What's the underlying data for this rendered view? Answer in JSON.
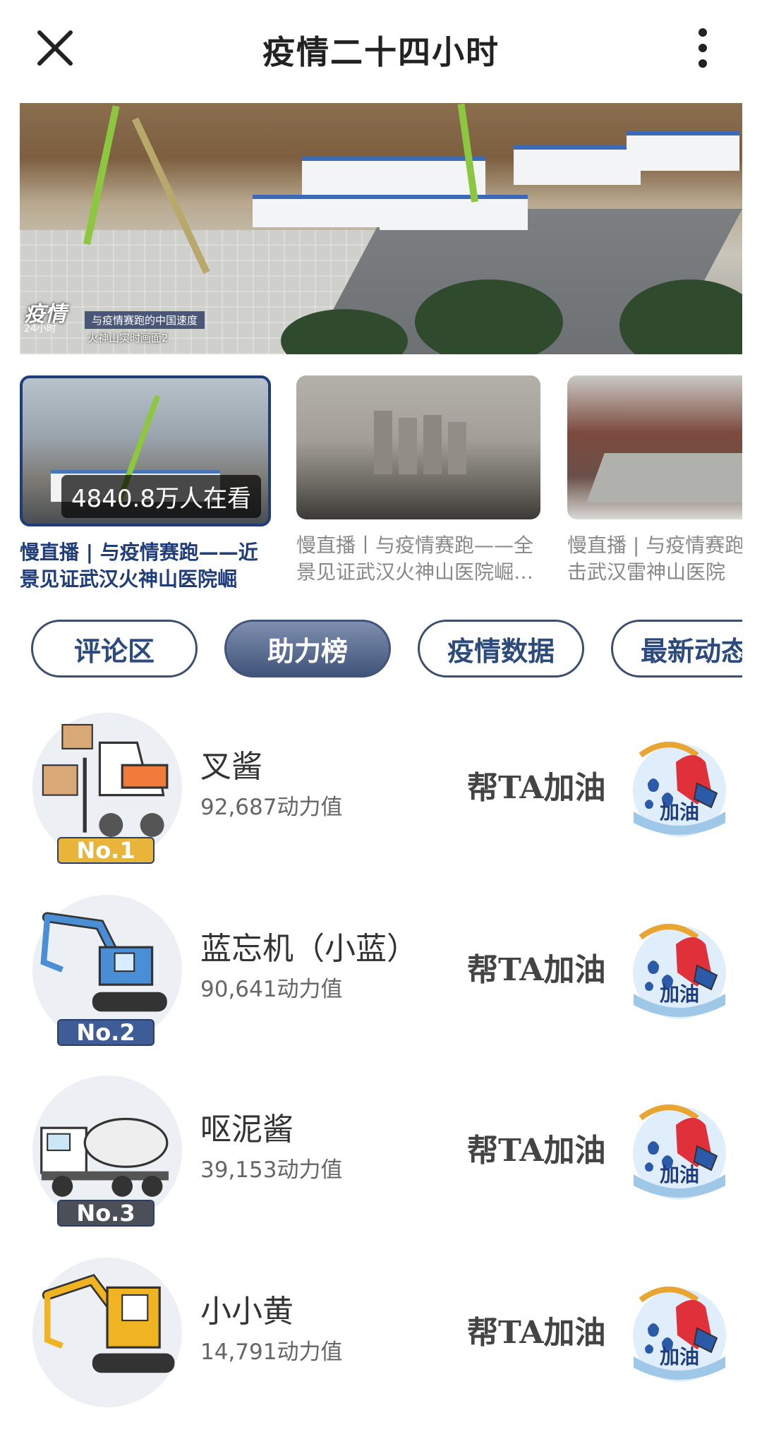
{
  "header": {
    "title": "疫情二十四小时",
    "close_icon": "close-icon",
    "more_icon": "more-vertical-icon"
  },
  "hero": {
    "logo_big": "疫情",
    "logo_small": "24小时",
    "caption1": "与疫情赛跑的中国速度",
    "caption2": "火神山实时画面2"
  },
  "thumbnails": [
    {
      "caption": "慢直播 | 与疫情赛跑——近景见证武汉火神山医院崛起…",
      "viewers": "4840.8万人在看",
      "active": true
    },
    {
      "caption": "慢直播丨与疫情赛跑——全景见证武汉火神山医院崛…",
      "active": false
    },
    {
      "caption": "慢直播 | 与疫情赛跑——直击武汉雷神山医院",
      "active": false
    }
  ],
  "tabs": [
    {
      "label": "评论区",
      "active": false
    },
    {
      "label": "助力榜",
      "active": true
    },
    {
      "label": "疫情数据",
      "active": false
    },
    {
      "label": "最新动态",
      "active": false
    }
  ],
  "ranking": [
    {
      "rank_label": "No.1",
      "name": "叉酱",
      "value": "92,687动力值",
      "cheer": "帮TA加油",
      "fuel_label": "加油",
      "badge_color": "#e8b43a",
      "icon": "forklift-icon"
    },
    {
      "rank_label": "No.2",
      "name": "蓝忘机（小蓝）",
      "value": "90,641动力值",
      "cheer": "帮TA加油",
      "fuel_label": "加油",
      "badge_color": "#3e5d96",
      "icon": "blue-excavator-icon"
    },
    {
      "rank_label": "No.3",
      "name": "呕泥酱",
      "value": "39,153动力值",
      "cheer": "帮TA加油",
      "fuel_label": "加油",
      "badge_color": "#4a4f58",
      "icon": "cement-mixer-icon"
    },
    {
      "name": "小小黄",
      "value": "14,791动力值",
      "cheer": "帮TA加油",
      "fuel_label": "加油",
      "icon": "yellow-excavator-icon"
    }
  ],
  "colors": {
    "accent": "#1f3d7a",
    "tab_active": "#41547a",
    "fuel_red": "#e0303a",
    "fuel_blue": "#2a5aa8"
  }
}
